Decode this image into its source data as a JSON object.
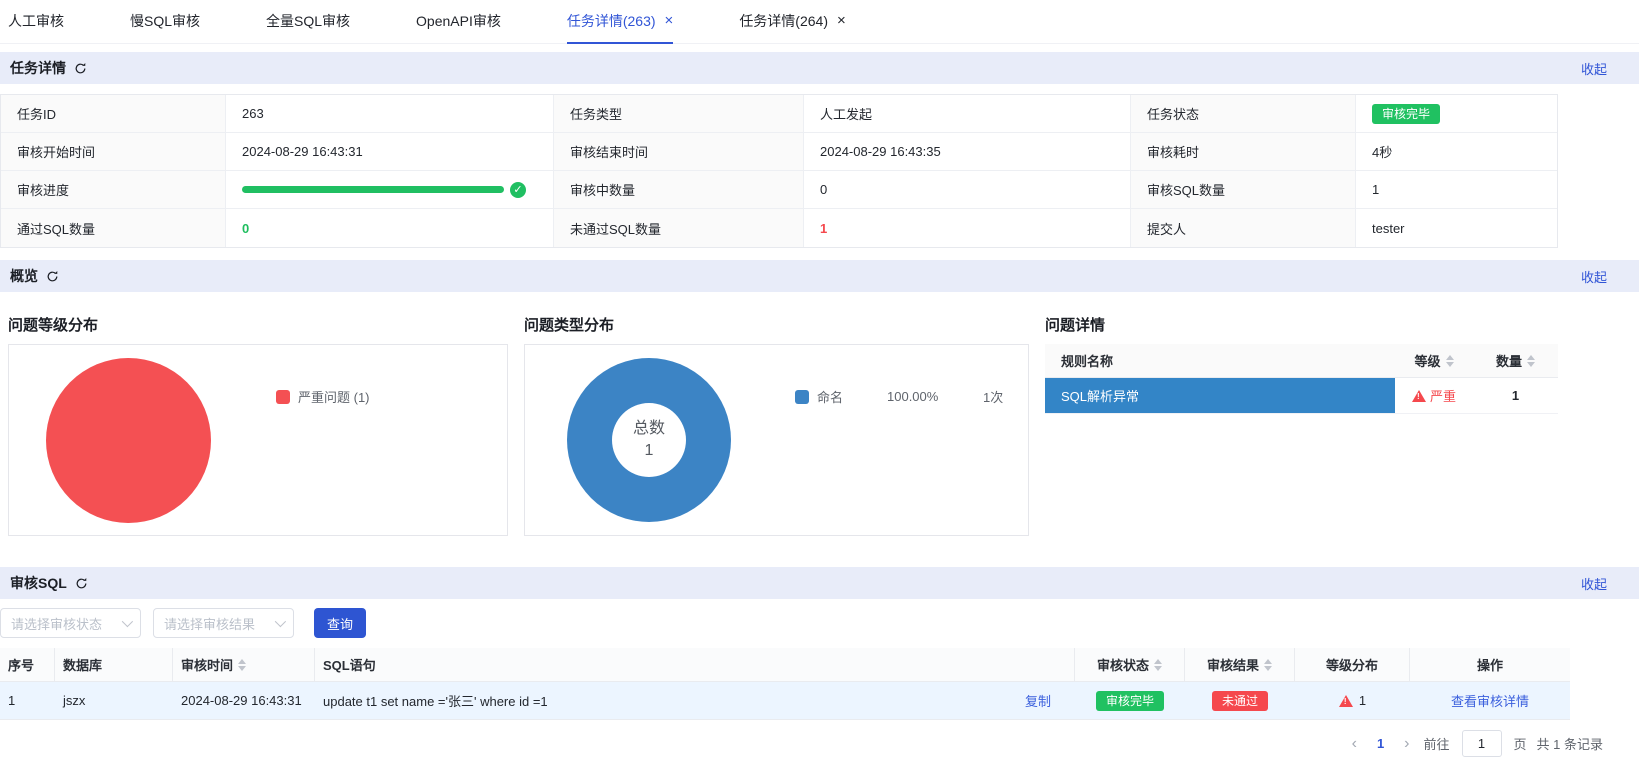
{
  "colors": {
    "accent": "#3155d6",
    "band_bg": "#e8ecf9",
    "green": "#20c161",
    "red": "#f5484d",
    "pie_red": "#f45053",
    "donut_blue": "#3c84c5",
    "issue_row_blue": "#3385c7",
    "row_highlight": "#ecf5ff"
  },
  "tabbar": {
    "close_icon": "×",
    "tabs": [
      {
        "label": "人工审核",
        "active": false
      },
      {
        "label": "慢SQL审核",
        "active": false
      },
      {
        "label": "全量SQL审核",
        "active": false
      },
      {
        "label": "OpenAPI审核",
        "active": false
      },
      {
        "label": "任务详情(263)",
        "active": true,
        "closable": true
      },
      {
        "label": "任务详情(264)",
        "active": false,
        "closable": true
      }
    ]
  },
  "task_panel": {
    "title": "任务详情",
    "collapse": "收起",
    "fields": {
      "task_id": {
        "label": "任务ID",
        "value": "263"
      },
      "task_type": {
        "label": "任务类型",
        "value": "人工发起"
      },
      "task_status": {
        "label": "任务状态",
        "value": "审核完毕"
      },
      "start_time": {
        "label": "审核开始时间",
        "value": "2024-08-29 16:43:31"
      },
      "end_time": {
        "label": "审核结束时间",
        "value": "2024-08-29 16:43:35"
      },
      "duration": {
        "label": "审核耗时",
        "value": "4秒"
      },
      "progress": {
        "label": "审核进度",
        "percent": 100,
        "check": "✓"
      },
      "auditing_count": {
        "label": "审核中数量",
        "value": "0"
      },
      "sql_count": {
        "label": "审核SQL数量",
        "value": "1"
      },
      "passed_count": {
        "label": "通过SQL数量",
        "value": "0"
      },
      "failed_count": {
        "label": "未通过SQL数量",
        "value": "1"
      },
      "submitter": {
        "label": "提交人",
        "value": "tester"
      }
    }
  },
  "overview": {
    "title": "概览",
    "collapse": "收起",
    "level_chart": {
      "title": "问题等级分布",
      "legend": "严重问题 (1)"
    },
    "type_chart": {
      "title": "问题类型分布",
      "center_label": "总数",
      "center_value": "1",
      "legend_name": "命名",
      "legend_percent": "100.00%",
      "legend_count": "1次"
    },
    "issues": {
      "title": "问题详情",
      "headers": {
        "rule": "规则名称",
        "level": "等级",
        "count": "数量"
      },
      "rows": [
        {
          "rule": "SQL解析异常",
          "level": "严重",
          "count": "1"
        }
      ]
    }
  },
  "audit_sql": {
    "title": "审核SQL",
    "collapse": "收起",
    "filters": {
      "status_placeholder": "请选择审核状态",
      "result_placeholder": "请选择审核结果",
      "query": "查询"
    },
    "headers": {
      "no": "序号",
      "db": "数据库",
      "time": "审核时间",
      "sql": "SQL语句",
      "status": "审核状态",
      "result": "审核结果",
      "levels": "等级分布",
      "action": "操作"
    },
    "rows": [
      {
        "no": "1",
        "db": "jszx",
        "time": "2024-08-29 16:43:31",
        "sql": "update t1 set name ='张三' where id =1",
        "copy": "复制",
        "status": "审核完毕",
        "result": "未通过",
        "level_count": "1",
        "action": "查看审核详情"
      }
    ]
  },
  "pagination": {
    "prev": "‹",
    "page": "1",
    "next": "›",
    "goto_label": "前往",
    "goto_value": "1",
    "unit": "页",
    "total": "共 1 条记录"
  },
  "chart_data": [
    {
      "type": "pie",
      "title": "问题等级分布",
      "labels": [
        "严重问题"
      ],
      "values": [
        1
      ],
      "colors": [
        "#f45053"
      ],
      "legend_position": "right"
    },
    {
      "type": "pie",
      "subtype": "donut",
      "title": "问题类型分布",
      "labels": [
        "命名"
      ],
      "values": [
        1
      ],
      "percents": [
        "100.00%"
      ],
      "counts": [
        "1次"
      ],
      "center_label": "总数",
      "center_value": 1,
      "colors": [
        "#3c84c5"
      ],
      "legend_position": "right"
    }
  ]
}
